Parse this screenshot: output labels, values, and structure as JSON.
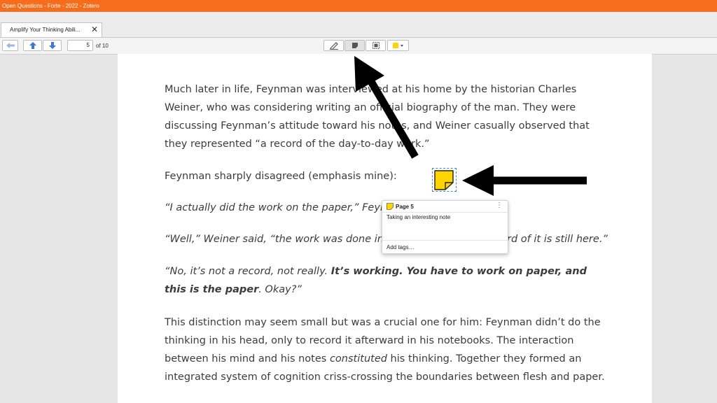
{
  "window": {
    "title": "Open Questions - Forte - 2022 - Zotero"
  },
  "tab": {
    "label": "Amplify Your Thinking Abili...",
    "close_glyph": "✕"
  },
  "toolbar": {
    "page_value": "5",
    "page_count": "of 10",
    "annotation_color": "#ffd400"
  },
  "document": {
    "p1": "Much later in life, Feynman was interviewed at his home by the historian Charles Weiner, who was considering writing an official biography of the man. They were discussing Feynman’s attitude toward his notes, and Weiner casually observed that they represented “a record of the day-to-day work.”",
    "p2": "Feynman sharply disagreed (emphasis mine):",
    "p3": "“I actually did the work on the paper,” Feynman said.",
    "p4": "“Well,” Weiner said, “the work was done in your head, but the record of it is still here.”",
    "p5_start": "“No, it’s not a record, not really. ",
    "p5_bold1": "It’s working. You have to work on paper, and this is the paper",
    "p5_end": ". Okay?”",
    "p6_start": "This distinction may seem small but was a crucial one for him: Feynman didn’t do the thinking in his head, only to record it afterward in his notebooks. The interaction between his mind and his notes ",
    "p6_em": "constituted",
    "p6_end": " his thinking. Together they formed an integrated system of cognition criss-crossing the boundaries between flesh and paper."
  },
  "note_popup": {
    "page_label": "Page 5",
    "comment": "Taking an interesting note",
    "tags_placeholder": "Add tags…",
    "more_glyph": "⋮"
  }
}
